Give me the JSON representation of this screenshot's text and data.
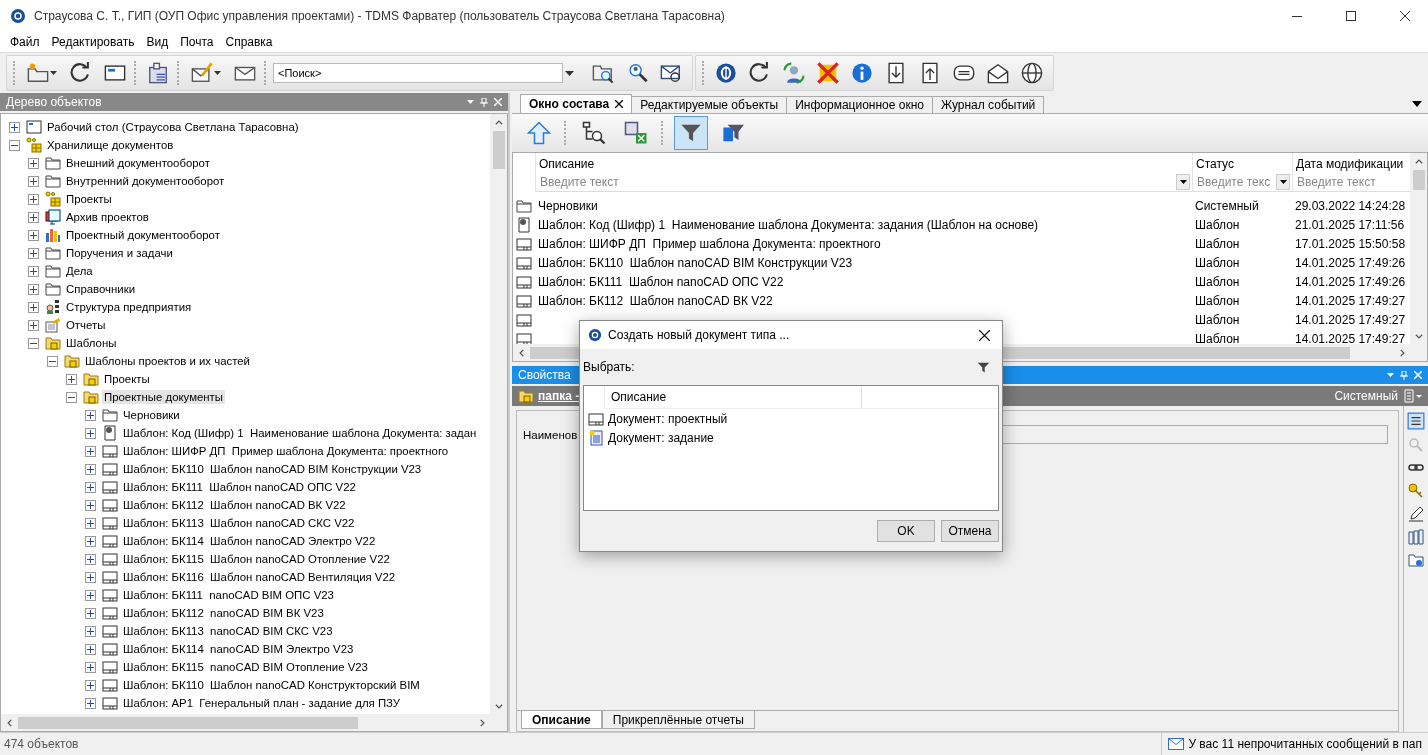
{
  "window": {
    "title": "Страусова С. Т., ГИП (ОУП Офис управления проектами) - TDMS Фарватер (пользователь Страусова Светлана Тарасовна)"
  },
  "menu": [
    "Файл",
    "Редактировать",
    "Вид",
    "Почта",
    "Справка"
  ],
  "toolbar": {
    "search": "<Поиск>"
  },
  "tree_panel": {
    "title": "Дерево объектов",
    "count": "474 объектов",
    "items": [
      {
        "label": "Рабочий стол (Страусова Светлана Тарасовна)",
        "kind": "desktop",
        "expanded": false,
        "selected": false
      },
      {
        "label": "Хранилище документов",
        "kind": "storage",
        "expanded": true,
        "selected": false,
        "children": [
          {
            "label": "Внешний документооборот",
            "kind": "folder",
            "expanded": false,
            "selected": false
          },
          {
            "label": "Внутренний документооборот",
            "kind": "folder",
            "expanded": false,
            "selected": false
          },
          {
            "label": "Проекты",
            "kind": "storage",
            "expanded": false,
            "selected": false
          },
          {
            "label": "Архив проектов",
            "kind": "archive",
            "expanded": false,
            "selected": false
          },
          {
            "label": "Проектный документооборот",
            "kind": "chart",
            "expanded": false,
            "selected": false
          },
          {
            "label": "Поручения и задачи",
            "kind": "folder",
            "expanded": false,
            "selected": false
          },
          {
            "label": "Дела",
            "kind": "folder",
            "expanded": false,
            "selected": false
          },
          {
            "label": "Справочники",
            "kind": "folder",
            "expanded": false,
            "selected": false
          },
          {
            "label": "Структура предприятия",
            "kind": "org",
            "expanded": false,
            "selected": false
          },
          {
            "label": "Отчеты",
            "kind": "report",
            "expanded": false,
            "selected": false
          },
          {
            "label": "Шаблоны",
            "kind": "template-folder",
            "expanded": true,
            "selected": false,
            "children": [
              {
                "label": "Шаблоны проектов и их частей",
                "kind": "template-folder",
                "expanded": true,
                "selected": false,
                "children": [
                  {
                    "label": "Проекты",
                    "kind": "template-folder",
                    "expanded": false,
                    "selected": false
                  },
                  {
                    "label": "Проектные документы",
                    "kind": "template-folder",
                    "expanded": true,
                    "selected": true,
                    "children": [
                      {
                        "label": "Черновики",
                        "kind": "folder",
                        "expanded": false,
                        "selected": false
                      },
                      {
                        "label": "Шаблон: Код (Шифр) 1  Наименование шаблона Документа: задан",
                        "kind": "stamp",
                        "expanded": false,
                        "selected": false
                      },
                      {
                        "label": "Шаблон: ШИФР ДП  Пример шаблона Документа: проектного",
                        "kind": "template",
                        "expanded": false,
                        "selected": false
                      },
                      {
                        "label": "Шаблон: БК110  Шаблон nanoCAD BIM Конструкции V23",
                        "kind": "template",
                        "expanded": false,
                        "selected": false
                      },
                      {
                        "label": "Шаблон: БК111  Шаблон nanoCAD ОПС V22",
                        "kind": "template",
                        "expanded": false,
                        "selected": false
                      },
                      {
                        "label": "Шаблон: БК112  Шаблон nanoCAD ВК V22",
                        "kind": "template",
                        "expanded": false,
                        "selected": false
                      },
                      {
                        "label": "Шаблон: БК113  Шаблон nanoCAD СКС V22",
                        "kind": "template",
                        "expanded": false,
                        "selected": false
                      },
                      {
                        "label": "Шаблон: БК114  Шаблон nanoCAD Электро V22",
                        "kind": "template",
                        "expanded": false,
                        "selected": false
                      },
                      {
                        "label": "Шаблон: БК115  Шаблон nanoCAD Отопление V22",
                        "kind": "template",
                        "expanded": false,
                        "selected": false
                      },
                      {
                        "label": "Шаблон: БК116  Шаблон nanoCAD Вентиляция V22",
                        "kind": "template",
                        "expanded": false,
                        "selected": false
                      },
                      {
                        "label": "Шаблон: БК111  nanoCAD BIM ОПС V23",
                        "kind": "template",
                        "expanded": false,
                        "selected": false
                      },
                      {
                        "label": "Шаблон: БК112  nanoCAD BIM ВК V23",
                        "kind": "template",
                        "expanded": false,
                        "selected": false
                      },
                      {
                        "label": "Шаблон: БК113  nanoCAD BIM СКС V23",
                        "kind": "template",
                        "expanded": false,
                        "selected": false
                      },
                      {
                        "label": "Шаблон: БК114  nanoCAD BIM Электро V23",
                        "kind": "template",
                        "expanded": false,
                        "selected": false
                      },
                      {
                        "label": "Шаблон: БК115  nanoCAD BIM Отопление V23",
                        "kind": "template",
                        "expanded": false,
                        "selected": false
                      },
                      {
                        "label": "Шаблон: БК110  Шаблон nanoCAD Конструкторский BIM",
                        "kind": "template",
                        "expanded": false,
                        "selected": false
                      },
                      {
                        "label": "Шаблон: АР1  Генеральный план - задание для ПЗУ",
                        "kind": "template",
                        "expanded": false,
                        "selected": false
                      }
                    ]
                  }
                ]
              }
            ]
          }
        ]
      }
    ]
  },
  "tabs": [
    {
      "label": "Окно состава",
      "selected": true
    },
    {
      "label": "Редактируемые объекты",
      "selected": false
    },
    {
      "label": "Информационное окно",
      "selected": false
    },
    {
      "label": "Журнал событий",
      "selected": false
    }
  ],
  "composition_toolbar": {
    "filter_active": true
  },
  "grid": {
    "columns": [
      {
        "title": "Описание",
        "placeholder": "Введите текст"
      },
      {
        "title": "Статус",
        "placeholder": "Введите текс"
      },
      {
        "title": "Дата модификации",
        "placeholder": "Введите текст"
      }
    ],
    "rows": [
      {
        "kind": "folder",
        "description": "Черновики",
        "status": "Системный",
        "modified": "29.03.2022 14:24:28"
      },
      {
        "kind": "stamp",
        "description": "Шаблон: Код (Шифр) 1  Наименование шаблона Документа: задания (Шаблон на основе)",
        "status": "Шаблон",
        "modified": "21.01.2025 17:11:56"
      },
      {
        "kind": "template",
        "description": "Шаблон: ШИФР ДП  Пример шаблона Документа: проектного",
        "status": "Шаблон",
        "modified": "17.01.2025 15:50:58"
      },
      {
        "kind": "template",
        "description": "Шаблон: БК110  Шаблон nanoCAD BIM Конструкции V23",
        "status": "Шаблон",
        "modified": "14.01.2025 17:49:26"
      },
      {
        "kind": "template",
        "description": "Шаблон: БК111  Шаблон nanoCAD ОПС V22",
        "status": "Шаблон",
        "modified": "14.01.2025 17:49:26"
      },
      {
        "kind": "template",
        "description": "Шаблон: БК112  Шаблон nanoCAD ВК V22",
        "status": "Шаблон",
        "modified": "14.01.2025 17:49:27"
      },
      {
        "kind": "template",
        "status": "Шаблон",
        "modified": "14.01.2025 17:49:27"
      },
      {
        "kind": "template",
        "status": "Шаблон",
        "modified": "14.01.2025 17:49:27"
      }
    ]
  },
  "properties": {
    "title": "Свойства",
    "object": "папка -",
    "status": "Системный",
    "field_label": "Наименов",
    "tabs": [
      {
        "label": "Описание",
        "selected": true
      },
      {
        "label": "Прикреплённые отчеты",
        "selected": false
      }
    ]
  },
  "dialog": {
    "title": "Создать новый документ типа ...",
    "prompt": "Выбрать:",
    "column": "Описание",
    "items": [
      {
        "kind": "template",
        "label": "Документ: проектный"
      },
      {
        "kind": "task",
        "label": "Документ: задание"
      }
    ],
    "buttons": [
      "OK",
      "Отмена"
    ]
  },
  "status_bar": {
    "message": "У вас 11 непрочитанных сообщений в пап"
  }
}
